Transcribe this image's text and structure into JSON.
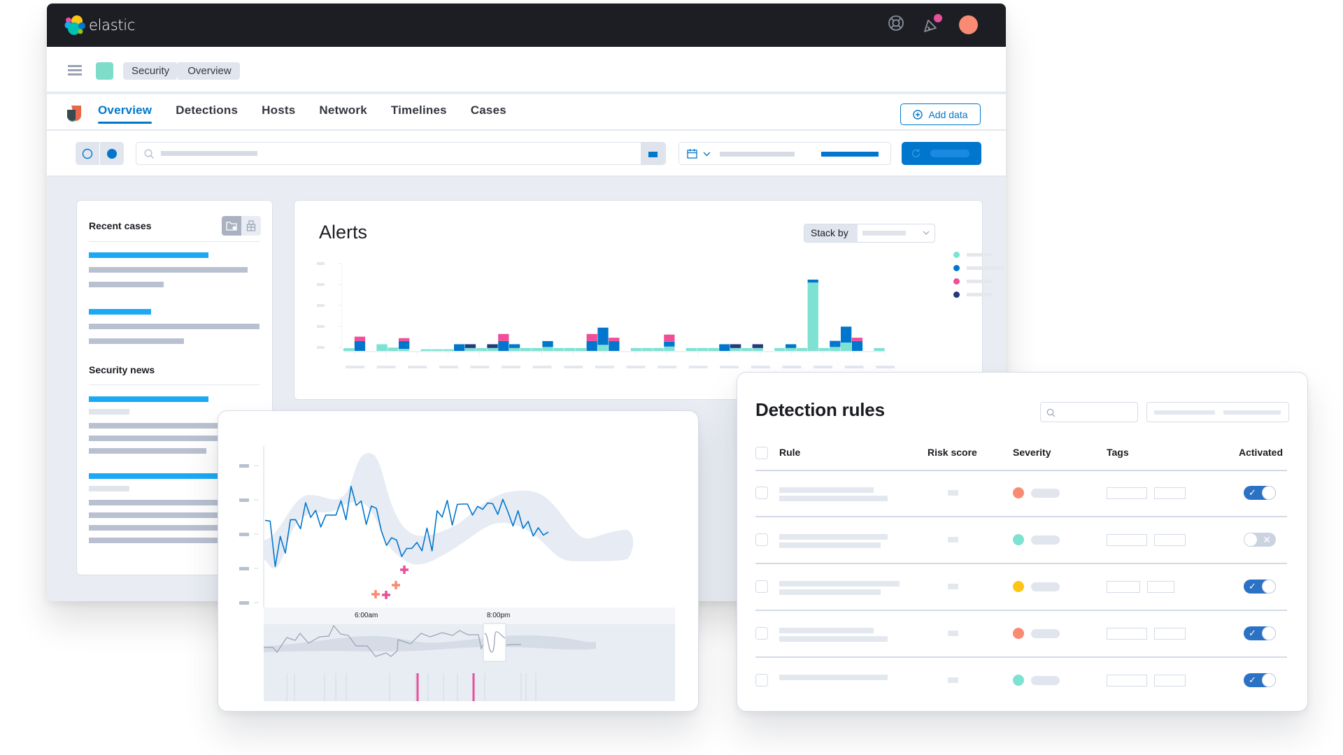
{
  "app": {
    "brand": "elastic",
    "header_icons": [
      "help-lifebuoy-icon",
      "newsfeed-megaphone-icon",
      "user-avatar"
    ],
    "notification_dot_color": "#e7509a",
    "avatar_color": "#f98b74"
  },
  "breadcrumbs": [
    "Security",
    "Overview"
  ],
  "nav": {
    "tabs": [
      {
        "label": "Overview",
        "active": true
      },
      {
        "label": "Detections",
        "active": false
      },
      {
        "label": "Hosts",
        "active": false
      },
      {
        "label": "Network",
        "active": false
      },
      {
        "label": "Timelines",
        "active": false
      },
      {
        "label": "Cases",
        "active": false
      }
    ],
    "add_data_label": "Add data"
  },
  "querybar": {
    "search_placeholder": "",
    "refresh_label": ""
  },
  "recent_cases": {
    "title": "Recent cases",
    "view_icons": [
      "folder-exclamation-icon",
      "package-icon"
    ]
  },
  "security_news": {
    "title": "Security news"
  },
  "alerts": {
    "title": "Alerts",
    "stack_by_label": "Stack by",
    "stack_by_value": "",
    "colors": {
      "teal": "#7de2d1",
      "blue": "#0077cc",
      "pink": "#f04e98",
      "navy": "#25397c"
    }
  },
  "chart_data": [
    {
      "type": "bar",
      "title": "Alerts",
      "stacked": true,
      "xlabel": "",
      "ylabel": "",
      "ylim": [
        0,
        4.3
      ],
      "grid": false,
      "legend_position": "right",
      "series_order": [
        "teal",
        "blue",
        "pink",
        "navy"
      ],
      "bars": [
        {
          "teal": 0.13,
          "blue": 0,
          "pink": 0,
          "navy": 0
        },
        {
          "teal": 0,
          "blue": 0.47,
          "pink": 0.21,
          "navy": 0
        },
        null,
        {
          "teal": 0.32,
          "blue": 0,
          "pink": 0,
          "navy": 0
        },
        {
          "teal": 0.16,
          "blue": 0,
          "pink": 0,
          "navy": 0
        },
        {
          "teal": 0.1,
          "blue": 0.37,
          "pink": 0.14,
          "navy": 0
        },
        null,
        {
          "teal": 0.08,
          "blue": 0,
          "pink": 0,
          "navy": 0
        },
        {
          "teal": 0.08,
          "blue": 0,
          "pink": 0,
          "navy": 0
        },
        {
          "teal": 0.08,
          "blue": 0,
          "pink": 0,
          "navy": 0
        },
        {
          "teal": 0,
          "blue": 0.32,
          "pink": 0,
          "navy": 0
        },
        {
          "teal": 0.14,
          "blue": 0,
          "pink": 0,
          "navy": 0.18
        },
        {
          "teal": 0.14,
          "blue": 0,
          "pink": 0,
          "navy": 0
        },
        {
          "teal": 0.14,
          "blue": 0,
          "pink": 0,
          "navy": 0.18
        },
        {
          "teal": 0,
          "blue": 0.47,
          "pink": 0.34,
          "navy": 0
        },
        {
          "teal": 0.14,
          "blue": 0.18,
          "pink": 0,
          "navy": 0
        },
        {
          "teal": 0.14,
          "blue": 0,
          "pink": 0,
          "navy": 0
        },
        {
          "teal": 0.14,
          "blue": 0,
          "pink": 0,
          "navy": 0
        },
        {
          "teal": 0.19,
          "blue": 0.28,
          "pink": 0,
          "navy": 0
        },
        {
          "teal": 0.14,
          "blue": 0,
          "pink": 0,
          "navy": 0
        },
        {
          "teal": 0.14,
          "blue": 0,
          "pink": 0,
          "navy": 0
        },
        {
          "teal": 0.14,
          "blue": 0,
          "pink": 0,
          "navy": 0
        },
        {
          "teal": 0,
          "blue": 0.47,
          "pink": 0.34,
          "navy": 0
        },
        {
          "teal": 0.29,
          "blue": 0.82,
          "pink": 0,
          "navy": 0
        },
        {
          "teal": 0,
          "blue": 0.47,
          "pink": 0.16,
          "navy": 0
        },
        null,
        {
          "teal": 0.14,
          "blue": 0,
          "pink": 0,
          "navy": 0
        },
        {
          "teal": 0.14,
          "blue": 0,
          "pink": 0,
          "navy": 0
        },
        {
          "teal": 0.14,
          "blue": 0,
          "pink": 0,
          "navy": 0
        },
        {
          "teal": 0.21,
          "blue": 0.23,
          "pink": 0.34,
          "navy": 0
        },
        null,
        {
          "teal": 0.14,
          "blue": 0,
          "pink": 0,
          "navy": 0
        },
        {
          "teal": 0.14,
          "blue": 0,
          "pink": 0,
          "navy": 0
        },
        {
          "teal": 0.14,
          "blue": 0,
          "pink": 0,
          "navy": 0
        },
        {
          "teal": 0,
          "blue": 0.32,
          "pink": 0,
          "navy": 0
        },
        {
          "teal": 0.14,
          "blue": 0,
          "pink": 0,
          "navy": 0.18
        },
        {
          "teal": 0.14,
          "blue": 0,
          "pink": 0,
          "navy": 0
        },
        {
          "teal": 0.14,
          "blue": 0,
          "pink": 0,
          "navy": 0.18
        },
        null,
        {
          "teal": 0.14,
          "blue": 0,
          "pink": 0,
          "navy": 0
        },
        {
          "teal": 0.14,
          "blue": 0.18,
          "pink": 0,
          "navy": 0
        },
        {
          "teal": 0.14,
          "blue": 0,
          "pink": 0,
          "navy": 0
        },
        {
          "teal": 3.26,
          "blue": 0.14,
          "pink": 0,
          "navy": 0
        },
        {
          "teal": 0.14,
          "blue": 0,
          "pink": 0,
          "navy": 0
        },
        {
          "teal": 0.19,
          "blue": 0.29,
          "pink": 0,
          "navy": 0
        },
        {
          "teal": 0.4,
          "blue": 0.76,
          "pink": 0,
          "navy": 0
        },
        {
          "teal": 0,
          "blue": 0.47,
          "pink": 0.16,
          "navy": 0
        },
        null,
        {
          "teal": 0.14,
          "blue": 0,
          "pink": 0,
          "navy": 0
        }
      ],
      "y_ticks": 5,
      "x_ticks": 18,
      "tick_labels": "placeholder (unlabeled)"
    },
    {
      "type": "line",
      "title": "",
      "xlabel": "",
      "ylabel": "",
      "x_tick_labels": [
        "6:00am",
        "8:00pm"
      ],
      "y_ticks": 5,
      "ylim": [
        0,
        4
      ],
      "series": [
        {
          "name": "actual",
          "color": "#0077cc",
          "values": [
            2.4,
            2.38,
            1.02,
            1.92,
            1.42,
            2.42,
            2.42,
            2.15,
            2.93,
            2.49,
            2.7,
            2.2,
            2.56,
            2.56,
            2.56,
            2.99,
            2.42,
            3.42,
            2.85,
            2.98,
            2.28,
            2.83,
            2.76,
            2.08,
            1.65,
            1.88,
            1.81,
            1.32,
            1.56,
            1.56,
            1.74,
            1.49,
            2.17,
            1.49,
            2.69,
            2.5,
            3.0,
            2.26,
            2.88,
            2.89,
            2.89,
            2.56,
            2.82,
            2.73,
            2.92,
            2.9,
            2.58,
            3.03,
            2.66,
            2.23,
            2.69,
            2.16,
            2.37,
            1.93,
            2.18,
            1.96,
            2.05
          ]
        }
      ],
      "expected_band": {
        "color": "#e7ebf3"
      },
      "anomalies": [
        {
          "index": 28,
          "severity": "minor",
          "color": "#f98b74"
        },
        {
          "index": 30,
          "severity": "major",
          "color": "#e7509a"
        },
        {
          "index": 32,
          "severity": "minor",
          "color": "#f98b74"
        },
        {
          "index": 33,
          "severity": "major",
          "color": "#e7509a"
        }
      ],
      "overview_markers": {
        "anomaly_color": "#e7509a",
        "count_normal": 14,
        "count_anomaly": 2
      }
    }
  ],
  "detection_rules": {
    "title": "Detection rules",
    "search_placeholder": "",
    "columns": [
      "Rule",
      "Risk score",
      "Severity",
      "Tags",
      "Activated"
    ],
    "rows": [
      {
        "severity_color": "#f98b74",
        "activated": true
      },
      {
        "severity_color": "#7de2d1",
        "activated": false
      },
      {
        "severity_color": "#fec514",
        "activated": true
      },
      {
        "severity_color": "#f98b74",
        "activated": true
      },
      {
        "severity_color": "#7de2d1",
        "activated": true
      }
    ]
  }
}
